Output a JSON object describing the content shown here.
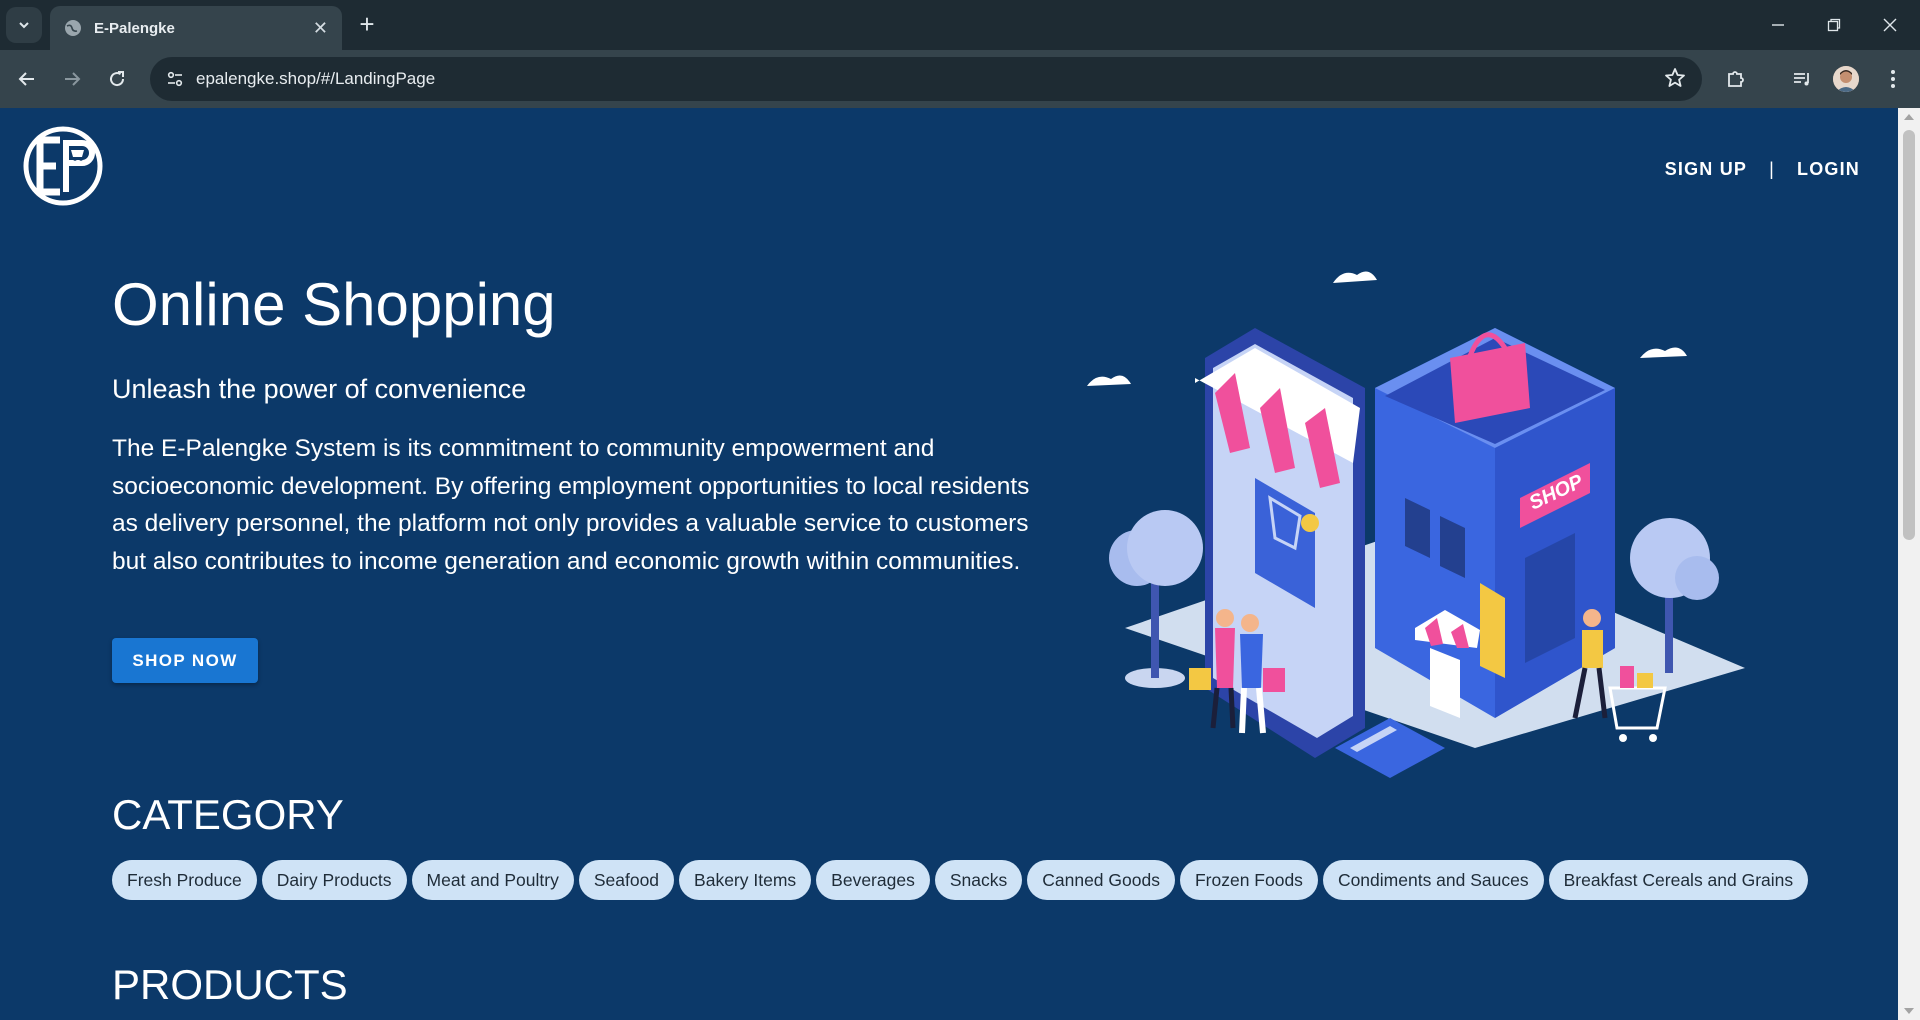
{
  "browser": {
    "tab_title": "E-Palengke",
    "url": "epalengke.shop/#/LandingPage"
  },
  "header": {
    "signup_label": "SIGN UP",
    "separator": "|",
    "login_label": "LOGIN"
  },
  "hero": {
    "title": "Online Shopping",
    "subtitle": "Unleash the power of convenience",
    "description": "The E-Palengke System is its commitment to community empowerment and socioeconomic development. By offering employment opportunities to local residents as delivery personnel, the platform not only provides a valuable service to customers but also contributes to income generation and economic growth within communities.",
    "cta_label": "SHOP NOW",
    "illustration_sign": "SHOP"
  },
  "category": {
    "title": "CATEGORY",
    "items": [
      "Fresh Produce",
      "Dairy Products",
      "Meat and Poultry",
      "Seafood",
      "Bakery Items",
      "Beverages",
      "Snacks",
      "Canned Goods",
      "Frozen Foods",
      "Condiments and Sauces",
      "Breakfast Cereals and Grains"
    ]
  },
  "products": {
    "title": "PRODUCTS"
  },
  "colors": {
    "page_bg": "#0c3969",
    "button": "#1976d2",
    "chip_bg": "#cfe3f6",
    "accent_pink": "#f0509c",
    "accent_blue": "#3a66e0"
  }
}
